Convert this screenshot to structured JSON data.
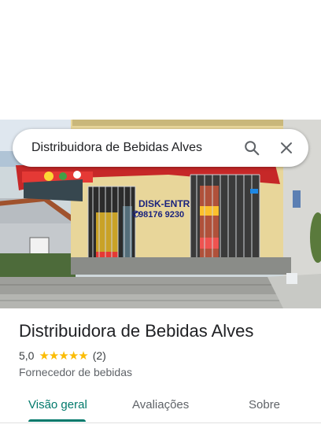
{
  "search": {
    "query": "Distribuidora de Bebidas Alves"
  },
  "icons": {
    "search": "search-icon",
    "close": "close-icon"
  },
  "photo": {
    "storefront_sign": "DISK-ENTREGA",
    "phone": "98176 9230"
  },
  "place": {
    "name": "Distribuidora de Bebidas Alves",
    "rating": "5,0",
    "stars": 5,
    "review_count": "(2)",
    "category": "Fornecedor de bebidas"
  },
  "tabs": [
    {
      "label": "Visão geral",
      "active": true
    },
    {
      "label": "Avaliações",
      "active": false
    },
    {
      "label": "Sobre",
      "active": false
    }
  ],
  "colors": {
    "accent": "#00796b",
    "star": "#fbbc04",
    "sign_red": "#c62828"
  }
}
